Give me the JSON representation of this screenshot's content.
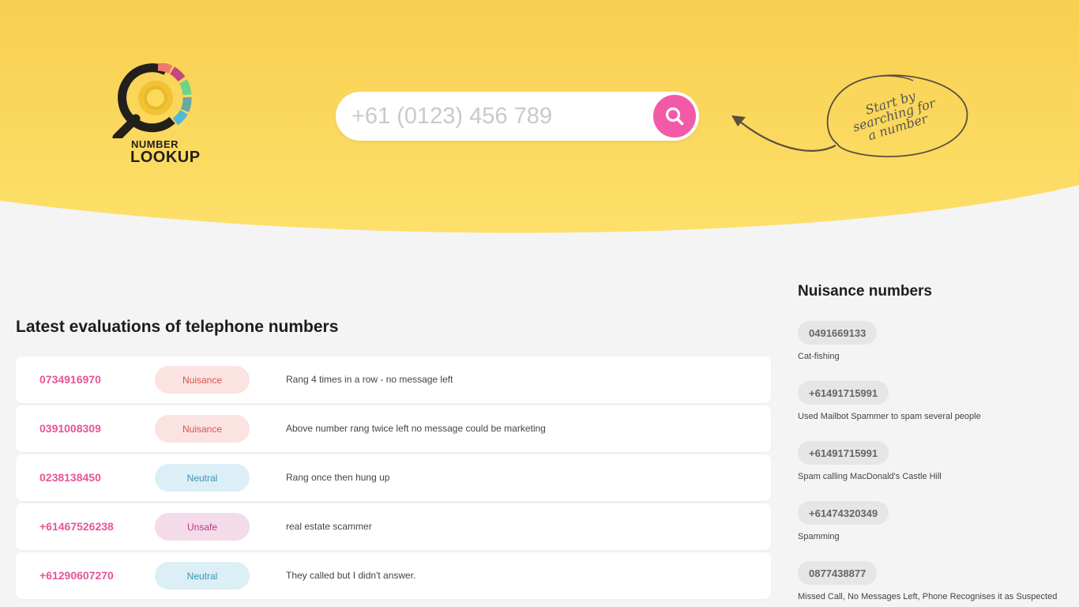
{
  "brand": {
    "line1": "NUMBER",
    "line2": "LOOKUP"
  },
  "search": {
    "placeholder": "+61 (0123) 456 789"
  },
  "callout": {
    "text": "Start by searching for a number"
  },
  "latest": {
    "title": "Latest evaluations of telephone numbers",
    "rows": [
      {
        "number": "0734916970",
        "rating": "Nuisance",
        "comment": "Rang 4 times in a row - no message left"
      },
      {
        "number": "0391008309",
        "rating": "Nuisance",
        "comment": "Above number rang twice left no message could be marketing"
      },
      {
        "number": "0238138450",
        "rating": "Neutral",
        "comment": "Rang once then hung up"
      },
      {
        "number": "+61467526238",
        "rating": "Unsafe",
        "comment": "real estate scammer"
      },
      {
        "number": "+61290607270",
        "rating": "Neutral",
        "comment": "They called but I didn't answer."
      }
    ]
  },
  "nuisance": {
    "title": "Nuisance numbers",
    "items": [
      {
        "number": "0491669133",
        "desc": "Cat-fishing"
      },
      {
        "number": "+61491715991",
        "desc": "Used Mailbot Spammer to spam several people"
      },
      {
        "number": "+61491715991",
        "desc": "Spam calling MacDonald's Castle Hill"
      },
      {
        "number": "+61474320349",
        "desc": "Spamming"
      },
      {
        "number": "0877438877",
        "desc": "Missed Call, No Messages Left, Phone Recognises it as Suspected"
      }
    ]
  },
  "colors": {
    "hero": "#fad95a",
    "accent": "#f25aa8",
    "number": "#e75498"
  }
}
